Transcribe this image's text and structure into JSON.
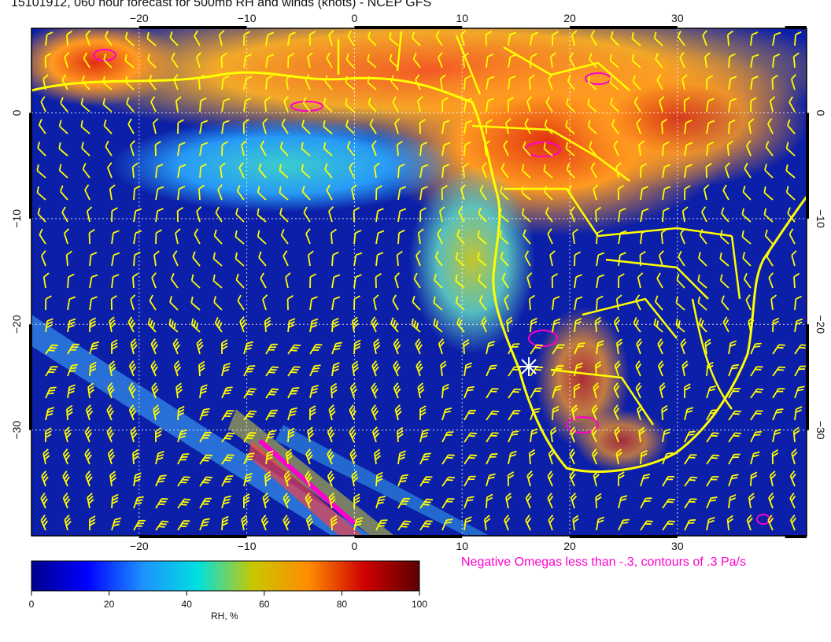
{
  "title": "15101912, 060 hour forecast for 500mb RH and winds (knots) - NCEP GFS",
  "footnote": "Negative Omegas less than -.3, contours of .3 Pa/s",
  "colorbar": {
    "label": "RH, %",
    "ticks": [
      "0",
      "20",
      "40",
      "60",
      "80",
      "100"
    ],
    "range": [
      0,
      100
    ],
    "colors": [
      "#00008b",
      "#0000ff",
      "#1e90ff",
      "#00e0e0",
      "#c8c800",
      "#ff8c00",
      "#d00000",
      "#5a0000"
    ]
  },
  "map": {
    "lon_ticks": [
      "−20",
      "−10",
      "0",
      "10",
      "20",
      "30"
    ],
    "lat_ticks": [
      "0",
      "−10",
      "−20",
      "−30"
    ],
    "lon_values": [
      -20,
      -10,
      0,
      10,
      20,
      30
    ],
    "lat_values": [
      0,
      -10,
      -20,
      -30
    ],
    "lon_range": [
      -30,
      42
    ],
    "lat_range": [
      -40,
      8
    ],
    "ocean_color": "#0c1fa8",
    "coast_color": "#ffff00",
    "omega_color": "#ff00cc",
    "barb_color": "#ffff00"
  }
}
